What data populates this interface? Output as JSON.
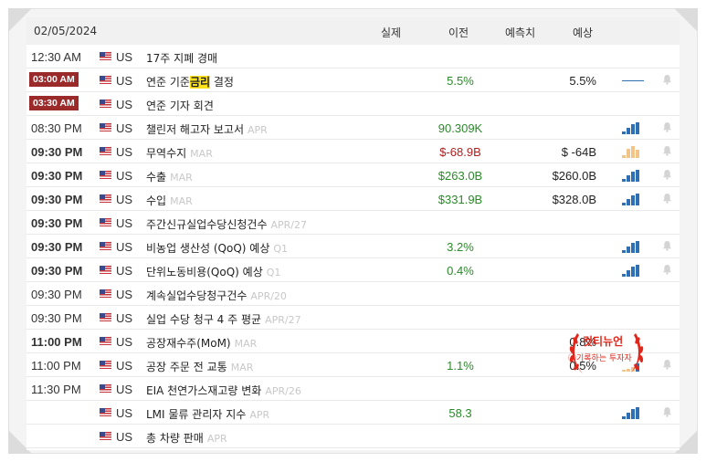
{
  "header": {
    "date": "02/05/2024",
    "col_actual": "실제",
    "col_previous": "이전",
    "col_consensus": "예측치",
    "col_forecast": "예상"
  },
  "rows": [
    {
      "time": "12:30 AM",
      "time_style": "normal",
      "country": "US",
      "event": "17주 지폐 경매",
      "period": "",
      "previous": "",
      "previous_color": "",
      "forecast": "",
      "spark": "none"
    },
    {
      "time": "03:00 AM",
      "time_style": "badge",
      "country": "US",
      "event_pre": "연준 기준",
      "event_hl": "금리",
      "event_post": " 결정",
      "period": "",
      "previous": "5.5%",
      "previous_color": "green",
      "forecast": "5.5%",
      "spark": "flat"
    },
    {
      "time": "03:30 AM",
      "time_style": "badge",
      "country": "US",
      "event": "연준 기자 회견",
      "period": "",
      "previous": "",
      "previous_color": "",
      "forecast": "",
      "spark": "none"
    },
    {
      "time": "08:30 PM",
      "time_style": "normal",
      "country": "US",
      "event": "챌린저 해고자 보고서",
      "period": "APR",
      "previous": "90.309K",
      "previous_color": "green",
      "forecast": "",
      "spark": "bars"
    },
    {
      "time": "09:30 PM",
      "time_style": "bold",
      "country": "US",
      "event": "무역수지",
      "period": "MAR",
      "previous": "$-68.9B",
      "previous_color": "red",
      "forecast": "$ -64B",
      "spark": "bars-orange"
    },
    {
      "time": "09:30 PM",
      "time_style": "bold",
      "country": "US",
      "event": "수출",
      "period": "MAR",
      "previous": "$263.0B",
      "previous_color": "green",
      "forecast": "$260.0B",
      "spark": "bars"
    },
    {
      "time": "09:30 PM",
      "time_style": "bold",
      "country": "US",
      "event": "수입",
      "period": "MAR",
      "previous": "$331.9B",
      "previous_color": "green",
      "forecast": "$328.0B",
      "spark": "bars"
    },
    {
      "time": "09:30 PM",
      "time_style": "bold",
      "country": "US",
      "event": "주간신규실업수당신청건수",
      "period": "APR/27",
      "previous": "",
      "previous_color": "",
      "forecast": "",
      "spark": "none"
    },
    {
      "time": "09:30 PM",
      "time_style": "bold",
      "country": "US",
      "event": "비농업 생산성 (QoQ) 예상",
      "period": "Q1",
      "previous": "3.2%",
      "previous_color": "green",
      "forecast": "",
      "spark": "bars"
    },
    {
      "time": "09:30 PM",
      "time_style": "bold",
      "country": "US",
      "event": "단위노동비용(QoQ) 예상",
      "period": "Q1",
      "previous": "0.4%",
      "previous_color": "green",
      "forecast": "",
      "spark": "bars"
    },
    {
      "time": "09:30 PM",
      "time_style": "normal",
      "country": "US",
      "event": "계속실업수당청구건수",
      "period": "APR/20",
      "previous": "",
      "previous_color": "",
      "forecast": "",
      "spark": "none"
    },
    {
      "time": "09:30 PM",
      "time_style": "normal",
      "country": "US",
      "event": "실업 수당 청구 4 주 평균",
      "period": "APR/27",
      "previous": "",
      "previous_color": "",
      "forecast": "",
      "spark": "none"
    },
    {
      "time": "11:00 PM",
      "time_style": "bold",
      "country": "US",
      "event": "공장재수주(MoM)",
      "period": "MAR",
      "previous": "",
      "previous_color": "",
      "forecast": "0.8%",
      "spark": "none"
    },
    {
      "time": "11:00 PM",
      "time_style": "normal",
      "country": "US",
      "event": "공장 주문 전 교통",
      "period": "MAR",
      "previous": "1.1%",
      "previous_color": "green",
      "forecast": "0.5%",
      "spark": "bars-mixed"
    },
    {
      "time": "11:30 PM",
      "time_style": "normal",
      "country": "US",
      "event": "EIA 천연가스재고량 변화",
      "period": "APR/26",
      "previous": "",
      "previous_color": "",
      "forecast": "",
      "spark": "none"
    },
    {
      "time": "",
      "time_style": "normal",
      "country": "US",
      "event": "LMI 물류 관리자 지수",
      "period": "APR",
      "previous": "58.3",
      "previous_color": "green",
      "forecast": "",
      "spark": "bars"
    },
    {
      "time": "",
      "time_style": "normal",
      "country": "US",
      "event": "총 차량 판매",
      "period": "APR",
      "previous": "",
      "previous_color": "",
      "forecast": "",
      "spark": "none"
    }
  ],
  "watermark": {
    "line1": "컷티뉴언",
    "line2": "ⓒ기록하는 투자자"
  },
  "colors": {
    "badge_bg": "#9b2b2b",
    "green": "#2a8a2a",
    "red": "#b02020",
    "spark_blue": "#2f6fb3",
    "spark_orange": "#f2c48a",
    "highlight": "#ffe21a",
    "watermark_red": "#e0271b"
  }
}
